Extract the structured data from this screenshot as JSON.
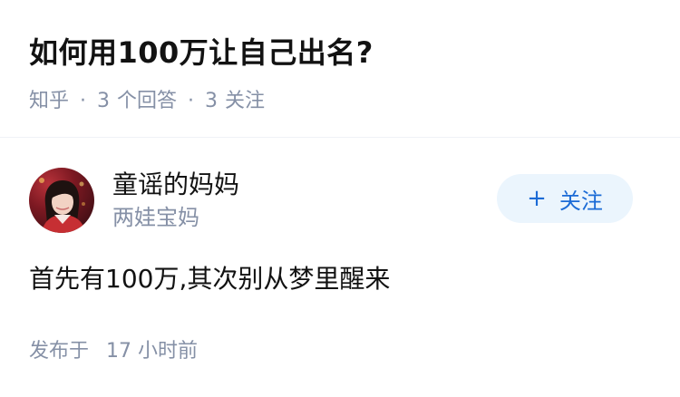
{
  "question": {
    "title": "如何用100万让自己出名?",
    "source": "知乎",
    "separator": "·",
    "answer_count": "3",
    "answer_label": "个回答",
    "follow_count": "3",
    "follow_label": "关注"
  },
  "author": {
    "name": "童谣的妈妈",
    "headline": "两娃宝妈",
    "follow_button_icon": "+",
    "follow_button_label": "关注"
  },
  "answer": {
    "content": "首先有100万,其次别从梦里醒来",
    "published_label": "发布于",
    "published_time": "17 小时前"
  },
  "colors": {
    "text_primary": "#121212",
    "text_secondary": "#8590a6",
    "accent": "#1b6bd6",
    "follow_bg": "#ebf5fd"
  }
}
